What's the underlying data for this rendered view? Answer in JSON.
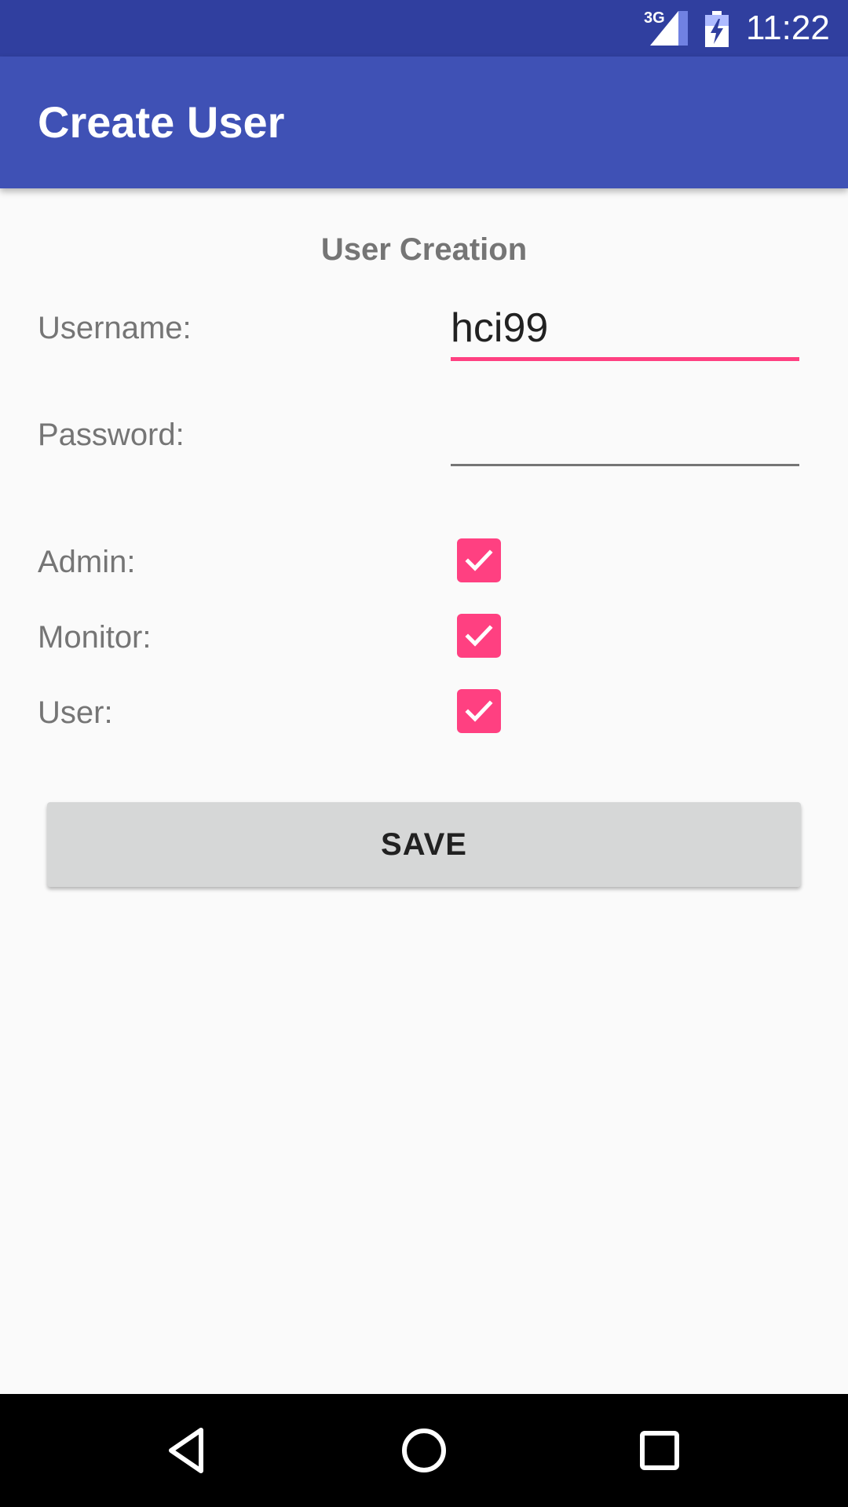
{
  "status_bar": {
    "network_type": "3G",
    "time": "11:22",
    "icons": [
      "signal-icon",
      "battery-charging-icon"
    ]
  },
  "app_bar": {
    "title": "Create User"
  },
  "form": {
    "heading": "User Creation",
    "username": {
      "label": "Username:",
      "value": "hci99"
    },
    "password": {
      "label": "Password:",
      "value": ""
    },
    "roles": [
      {
        "label": "Admin:",
        "checked": true
      },
      {
        "label": "Monitor:",
        "checked": true
      },
      {
        "label": "User:",
        "checked": true
      }
    ],
    "save_label": "SAVE"
  },
  "colors": {
    "status_bar": "#303f9f",
    "app_bar": "#3f51b5",
    "accent": "#ff4081",
    "background": "#fafafa"
  },
  "nav_bar": {
    "icons": [
      "back-icon",
      "home-icon",
      "recents-icon"
    ]
  }
}
